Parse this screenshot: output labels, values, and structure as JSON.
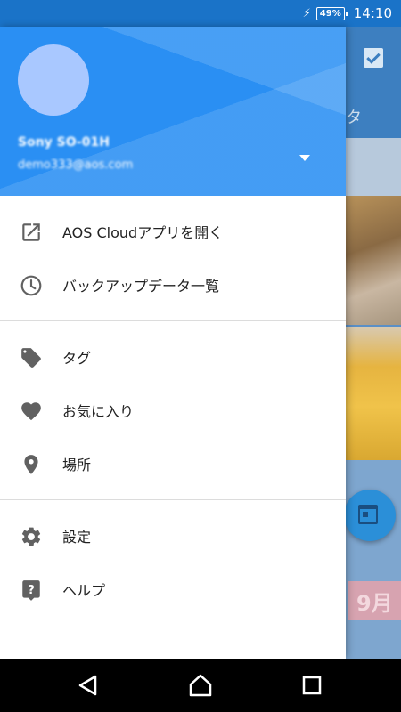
{
  "status_bar": {
    "battery": "49%",
    "time": "14:10",
    "icons": [
      "charging-bolt-icon",
      "battery-icon"
    ]
  },
  "background_app": {
    "title_fragment": "タ",
    "month_badge": "9月",
    "icons": [
      "checkbox-checked-icon",
      "calendar-icon"
    ]
  },
  "drawer": {
    "account": {
      "name": "Sony SO-01H",
      "email": "demo333@aos.com"
    },
    "menu_groups": [
      [
        {
          "label": "AOS Cloudアプリを開く",
          "icon": "open-external-icon"
        },
        {
          "label": "バックアップデータ一覧",
          "icon": "clock-icon"
        }
      ],
      [
        {
          "label": "タグ",
          "icon": "tag-icon"
        },
        {
          "label": "お気に入り",
          "icon": "heart-icon"
        },
        {
          "label": "場所",
          "icon": "location-pin-icon"
        }
      ],
      [
        {
          "label": "設定",
          "icon": "gear-icon"
        },
        {
          "label": "ヘルプ",
          "icon": "help-icon"
        }
      ]
    ]
  },
  "nav_bar": {
    "icons": [
      "back-icon",
      "home-icon",
      "recents-icon"
    ]
  },
  "colors": {
    "status_bar": "#1a73c8",
    "drawer_header": "#2a8ff3",
    "avatar": "#a9c8ff",
    "menu_icon": "#616161",
    "nav_bar": "#000000"
  }
}
